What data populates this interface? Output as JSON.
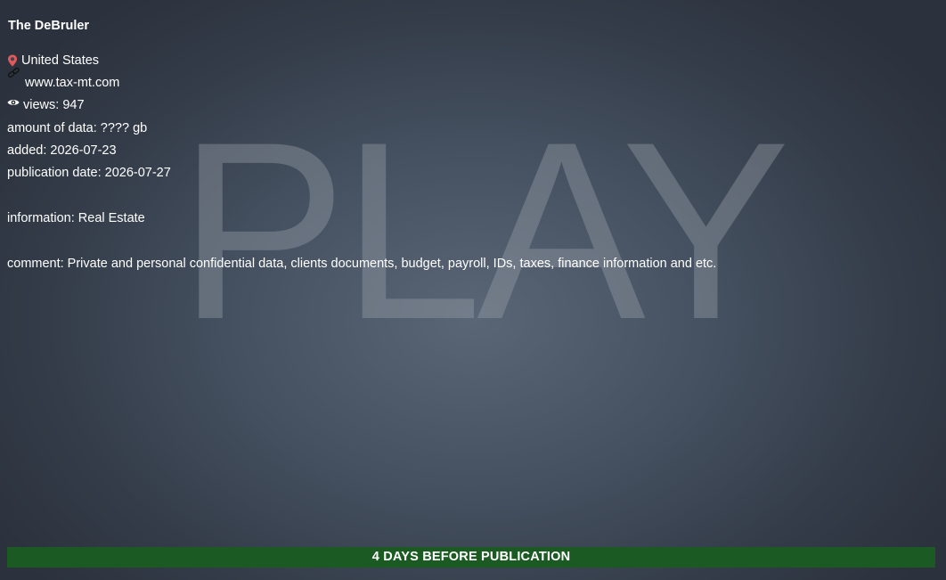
{
  "watermark": "PLAY",
  "victim": {
    "name": "The DeBruler",
    "country": "United States",
    "website": "www.tax-mt.com",
    "views": "views: 947",
    "amount_of_data": "amount of data: ???? gb",
    "added": "added: 2026-07-23",
    "publication_date": "publication date: 2026-07-27",
    "information": "information: Real Estate",
    "comment": "comment: Private and personal confidential data, clients documents, budget, payroll, IDs, taxes, finance information and etc."
  },
  "countdown": {
    "label": "4 DAYS BEFORE PUBLICATION"
  },
  "colors": {
    "pin": "#e05a5a",
    "countdown_bg": "#1c5a24"
  }
}
